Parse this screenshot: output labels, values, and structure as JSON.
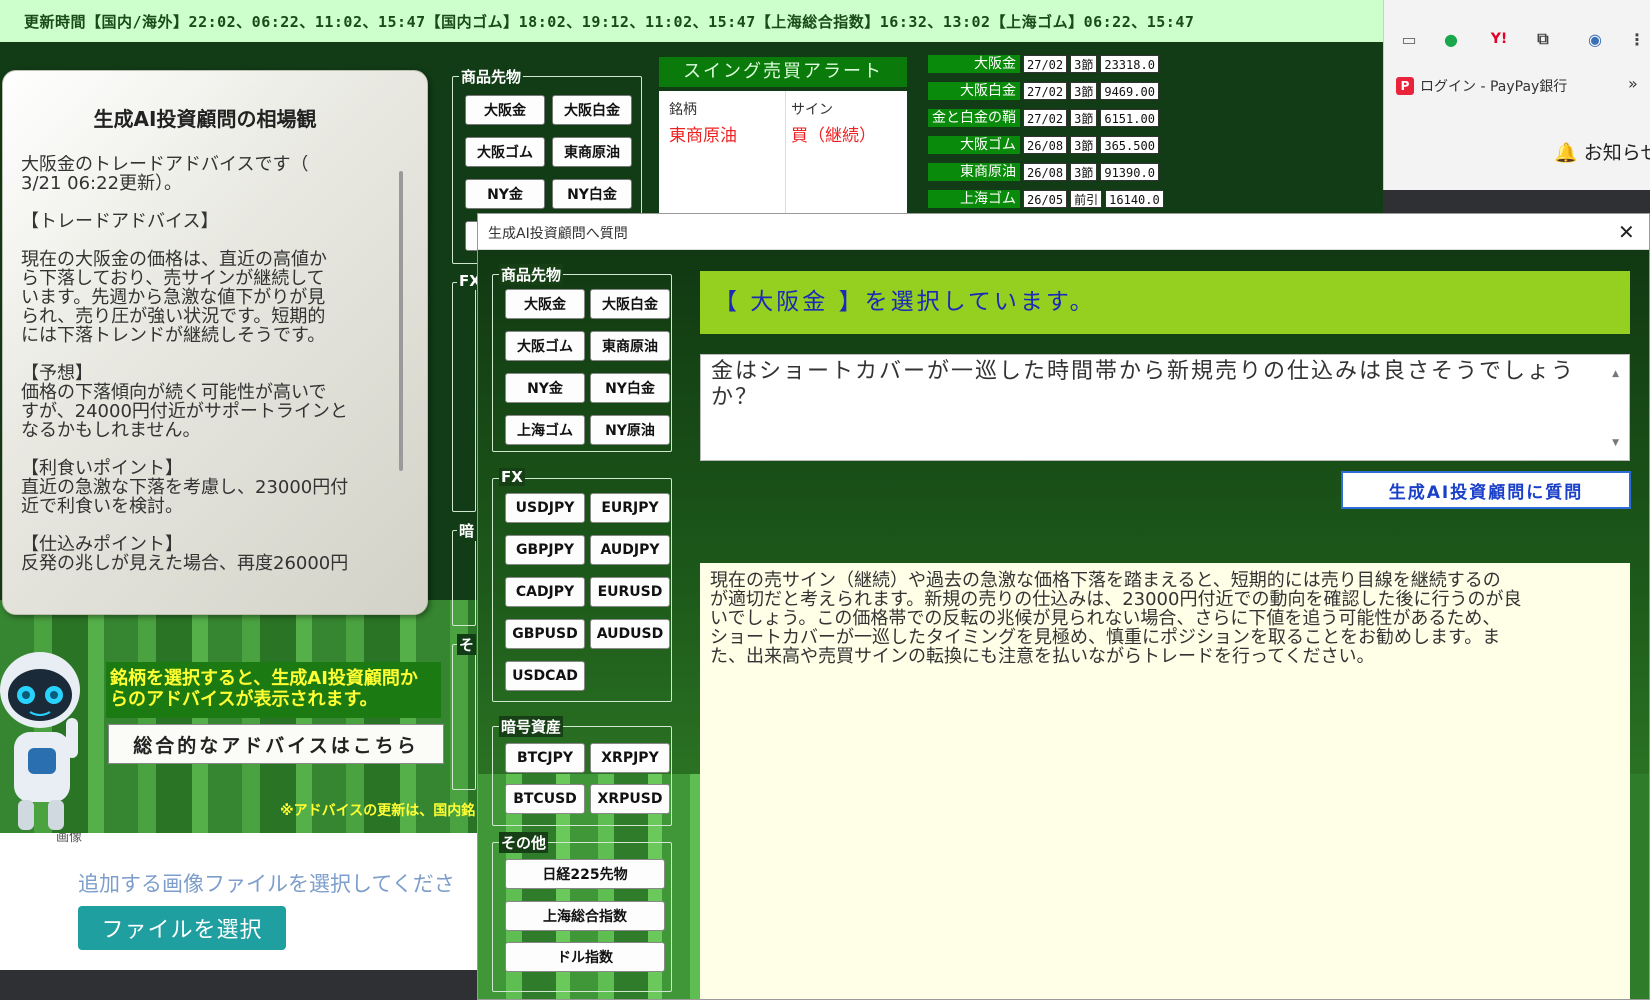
{
  "topbar": {
    "text": "更新時間【国内/海外】22:02、06:22、11:02、15:47【国内ゴム】18:02、19:12、11:02、15:47【上海総合指数】16:32、13:02【上海ゴム】06:22、15:47"
  },
  "advisor": {
    "title": "生成AI投資顧問の相場観",
    "body": "大阪金のトレードアドバイスです（\n3/21 06:22更新）。\n\n【トレードアドバイス】\n\n現在の大阪金の価格は、直近の高値か\nら下落しており、売サインが継続して\nいます。先週から急激な値下がりが見\nられ、売り圧が強い状況です。短期的\nには下落トレンドが継続しそうです。\n\n【予想】\n価格の下落傾向が続く可能性が高いで\nすが、24000円付近がサポートラインと\nなるかもしれません。\n\n【利食いポイント】\n直近の急激な下落を考慮し、23000円付\n近で利食いを検討。\n\n【仕込みポイント】\n反発の兆しが見えた場合、再度26000円"
  },
  "left_panel": {
    "advice_text": "銘柄を選択すると、生成AI投資顧問か\nらのアドバイスが表示されます。",
    "overall_button": "総合的なアドバイスはこちら",
    "update_note": "※アドバイスの更新は、国内銘"
  },
  "main_groups": {
    "commodity_label": "商品先物",
    "fx_label": "FX",
    "crypto_label": "暗",
    "other_label": "そ",
    "commodity_buttons": [
      "大阪金",
      "大阪白金",
      "大阪ゴム",
      "東商原油",
      "NY金",
      "NY白金"
    ]
  },
  "alert": {
    "title": "スイング売買アラート",
    "col_symbol": "銘柄",
    "col_sign": "サイン",
    "row_symbol": "東商原油",
    "row_sign": "買（継続）"
  },
  "prices": [
    {
      "name": "大阪金",
      "month": "27/02",
      "session": "3節",
      "price": "23318.0"
    },
    {
      "name": "大阪白金",
      "month": "27/02",
      "session": "3節",
      "price": "9469.00"
    },
    {
      "name": "金と白金の鞘",
      "month": "27/02",
      "session": "3節",
      "price": "6151.00"
    },
    {
      "name": "大阪ゴム",
      "month": "26/08",
      "session": "3節",
      "price": "365.500"
    },
    {
      "name": "東商原油",
      "month": "26/08",
      "session": "3節",
      "price": "91390.0"
    },
    {
      "name": "上海ゴム",
      "month": "26/05",
      "session": "前引",
      "price": "16140.0"
    }
  ],
  "browser": {
    "bookmark": "ログイン - PayPay銀行",
    "more": "»",
    "notice": "お知らせ",
    "icons": [
      "message-icon",
      "share-icon",
      "yahoo-icon",
      "extension-icon",
      "profile-icon",
      "menu-icon"
    ]
  },
  "web": {
    "image_label": "画像",
    "file_hint": "追加する画像ファイルを選択してくださ",
    "file_button": "ファイルを選択"
  },
  "dialog": {
    "title": "生成AI投資顧問へ質問",
    "close": "✕",
    "selected": "【 大阪金 】を選択しています。",
    "question": "金はショートカバーが一巡した時間帯から新規売りの仕込みは良さそうでしょうか？",
    "ask_button": "生成AI投資顧問に質問",
    "answer": "現在の売サイン（継続）や過去の急激な価格下落を踏まえると、短期的には売り目線を継続するの\nが適切だと考えられます。新規の売りの仕込みは、23000円付近での動向を確認した後に行うのが良\nいでしょう。この価格帯での反転の兆候が見られない場合、さらに下値を追う可能性があるため、\nショートカバーが一巡したタイミングを見極め、慎重にポジションを取ることをお勧めします。ま\nた、出来高や売買サインの転換にも注意を払いながらトレードを行ってください。",
    "groups": {
      "commodity_label": "商品先物",
      "fx_label": "FX",
      "crypto_label": "暗号資産",
      "other_label": "その他"
    },
    "commodity_buttons": [
      "大阪金",
      "大阪白金",
      "大阪ゴム",
      "東商原油",
      "NY金",
      "NY白金",
      "上海ゴム",
      "NY原油"
    ],
    "fx_buttons": [
      "USDJPY",
      "EURJPY",
      "GBPJPY",
      "AUDJPY",
      "CADJPY",
      "EURUSD",
      "GBPUSD",
      "AUDUSD",
      "USDCAD"
    ],
    "crypto_buttons": [
      "BTCJPY",
      "XRPJPY",
      "BTCUSD",
      "XRPUSD"
    ],
    "other_buttons": [
      "日経225先物",
      "上海総合指数",
      "ドル指数"
    ]
  }
}
